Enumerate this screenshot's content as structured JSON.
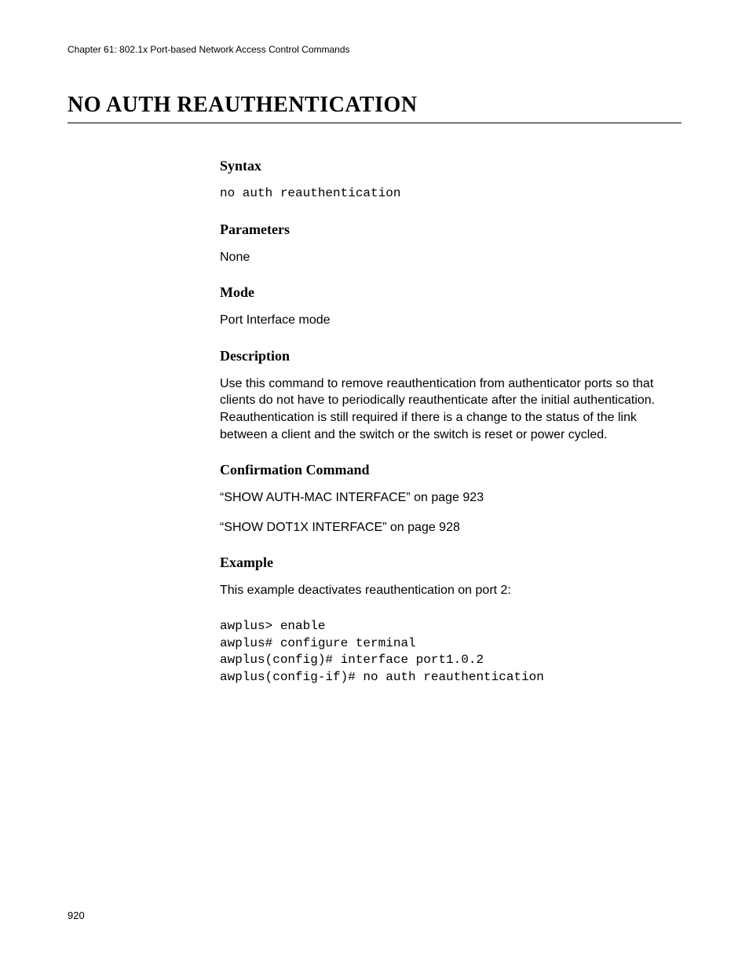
{
  "chapter_header": "Chapter 61: 802.1x Port-based Network Access Control Commands",
  "title": "NO AUTH REAUTHENTICATION",
  "sections": {
    "syntax": {
      "heading": "Syntax",
      "code": "no auth reauthentication"
    },
    "parameters": {
      "heading": "Parameters",
      "text": "None"
    },
    "mode": {
      "heading": "Mode",
      "text": "Port Interface mode"
    },
    "description": {
      "heading": "Description",
      "text": "Use this command to remove reauthentication from authenticator ports so that clients do not have to periodically reauthenticate after the initial authentication. Reauthentication is still required if there is a change to the status of the link between a client and the switch or the switch is reset or power cycled."
    },
    "confirmation": {
      "heading": "Confirmation Command",
      "line1": "“SHOW AUTH-MAC INTERFACE” on page 923",
      "line2": "“SHOW DOT1X INTERFACE” on page 928"
    },
    "example": {
      "heading": "Example",
      "intro": "This example deactivates reauthentication on port 2:",
      "code": "awplus> enable\nawplus# configure terminal\nawplus(config)# interface port1.0.2\nawplus(config-if)# no auth reauthentication"
    }
  },
  "page_number": "920"
}
